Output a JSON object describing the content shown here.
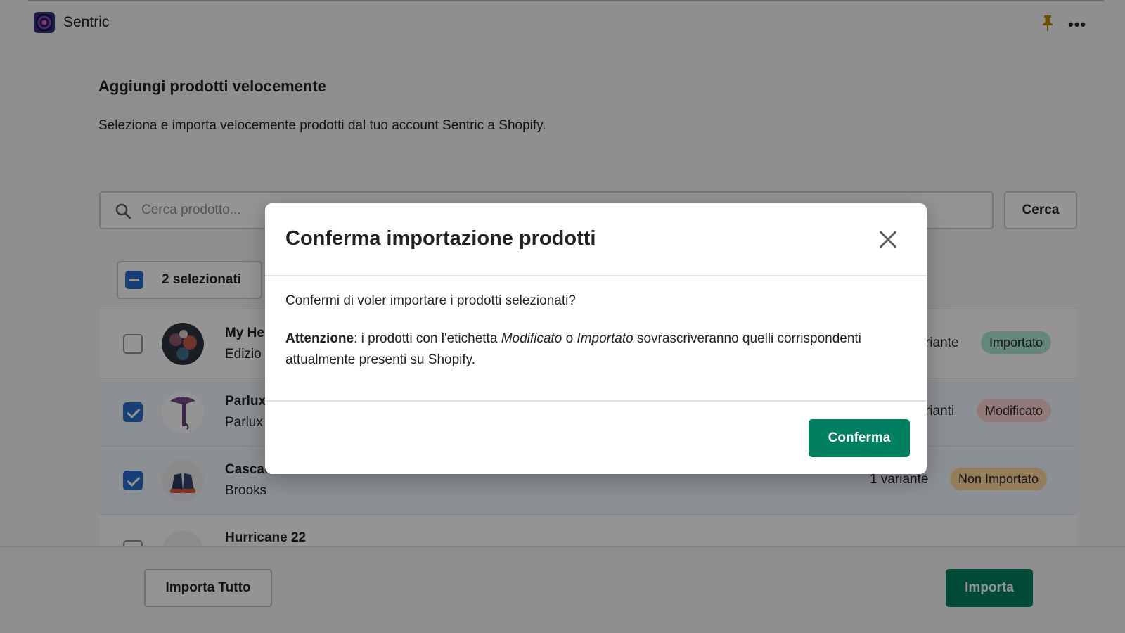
{
  "app": {
    "name": "Sentric",
    "logo_icon": "sentric-logo-icon",
    "pin_icon": "pin-icon",
    "more_icon": "more-horizontal-icon",
    "more_label": "•••"
  },
  "page": {
    "title": "Aggiungi prodotti velocemente",
    "description": "Seleziona e importa velocemente prodotti dal tuo account Sentric a Shopify."
  },
  "search": {
    "placeholder": "Cerca prodotto...",
    "value": "",
    "button_label": "Cerca"
  },
  "bulk": {
    "selected_label": "2 selezionati"
  },
  "products": [
    {
      "name": "My He",
      "vendor": "Edizio",
      "variants": "riante",
      "status": "Importato",
      "selected": false
    },
    {
      "name": "Parlux",
      "vendor": "Parlux",
      "variants": "rianti",
      "status": "Modificato",
      "selected": true
    },
    {
      "name": "Cascad",
      "vendor": "Brooks",
      "variants": "1 variante",
      "status": "Non Importato",
      "selected": true
    },
    {
      "name": "Hurricane 22",
      "vendor": "",
      "variants": "",
      "status": "",
      "selected": false
    }
  ],
  "footer": {
    "import_all_label": "Importa Tutto",
    "import_label": "Importa"
  },
  "modal": {
    "title": "Conferma importazione prodotti",
    "question": "Confermi di voler importare i prodotti selezionati?",
    "warning_label": "Attenzione",
    "warning_text_1": ": i prodotti con l'etichetta ",
    "warning_tag_1": "Modificato",
    "warning_text_2": " o ",
    "warning_tag_2": "Importato",
    "warning_text_3": " sovrascriveranno quelli corrispondenti attualmente presenti su Shopify.",
    "confirm_label": "Conferma",
    "close_icon": "close-icon"
  },
  "colors": {
    "primary": "#008060",
    "checkbox": "#2c6ecb",
    "badge_imported": "#aee9d1",
    "badge_modified": "#fed3d1",
    "badge_not_imported": "#ffd79d",
    "pin": "#b98900"
  }
}
